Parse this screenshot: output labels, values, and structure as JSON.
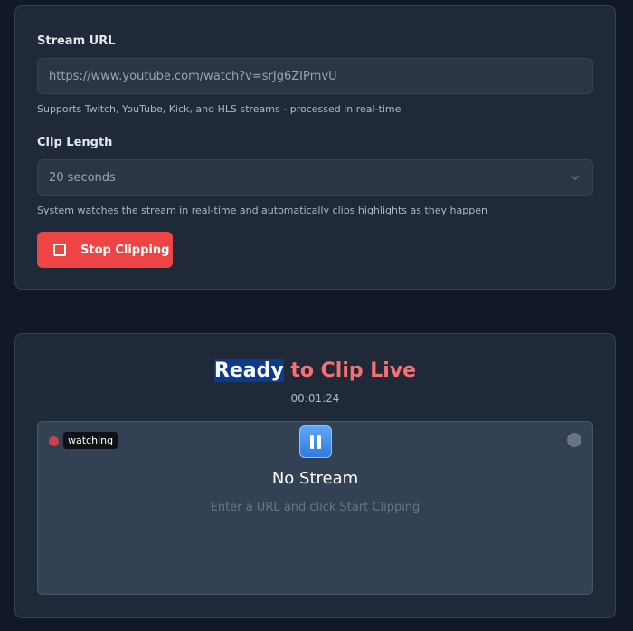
{
  "settings": {
    "stream_url_label": "Stream URL",
    "stream_url_value": "https://www.youtube.com/watch?v=srJg6ZIPmvU",
    "stream_url_hint": "Supports Twitch, YouTube, Kick, and HLS streams - processed in real-time",
    "clip_length_label": "Clip Length",
    "clip_length_value": "20 seconds",
    "clip_length_hint": "System watches the stream in real-time and automatically clips highlights as they happen",
    "stop_button_label": "Stop Clipping"
  },
  "player": {
    "title_highlight": "Ready",
    "title_rest": " to Clip Live",
    "timer": "00:01:24",
    "watching_badge": "watching",
    "status_title": "No Stream",
    "status_subtitle": "Enter a URL and click Start Clipping"
  },
  "colors": {
    "accent_red": "#ef4444",
    "title_red": "#f87171",
    "pause_blue": "#2f7be0"
  }
}
